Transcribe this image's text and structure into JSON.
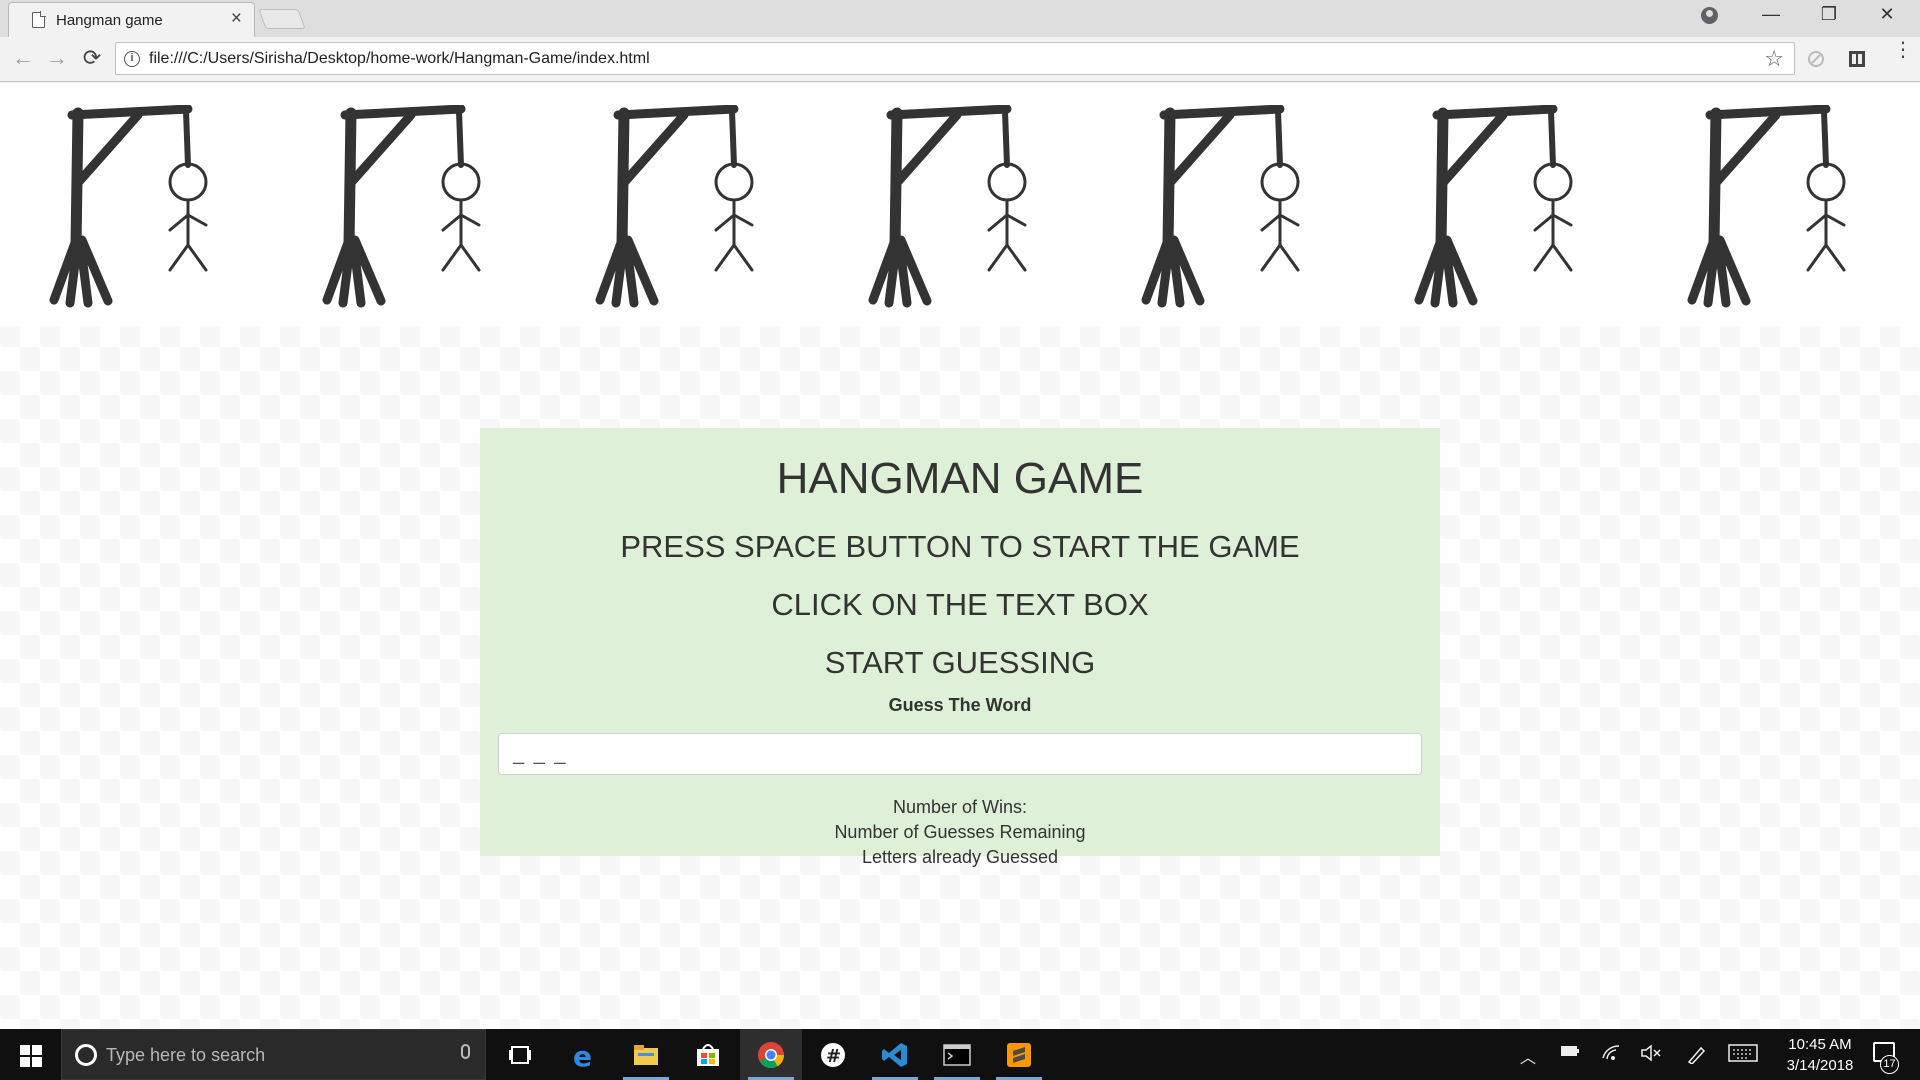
{
  "browser": {
    "tab_title": "Hangman game",
    "tab_close": "×",
    "url": "file:///C:/Users/Sirisha/Desktop/home-work/Hangman-Game/index.html",
    "window_controls": {
      "minimize": "—",
      "restore": "❐",
      "close": "✕"
    },
    "nav": {
      "back": "←",
      "forward": "→",
      "reload": "⟳"
    },
    "star": "☆",
    "menu": "⋮"
  },
  "page": {
    "gallows_count": 7,
    "title": "HANGMAN GAME",
    "instructions": [
      "PRESS SPACE BUTTON TO START THE GAME",
      "CLICK ON THE TEXT BOX",
      "START GUESSING"
    ],
    "guess_label": "Guess The Word",
    "word_display": "_ _ _",
    "stats": {
      "wins": "Number of Wins:",
      "guesses_remaining": "Number of Guesses Remaining",
      "letters_guessed": "Letters already Guessed"
    },
    "panel_color": "#dff0d8"
  },
  "taskbar": {
    "search_placeholder": "Type here to search",
    "apps": [
      "task-view",
      "edge",
      "file-explorer",
      "store",
      "chrome",
      "slack",
      "vscode",
      "terminal",
      "sublime-text"
    ],
    "clock_time": "10:45 AM",
    "clock_date": "3/14/2018",
    "notification_count": "17"
  }
}
